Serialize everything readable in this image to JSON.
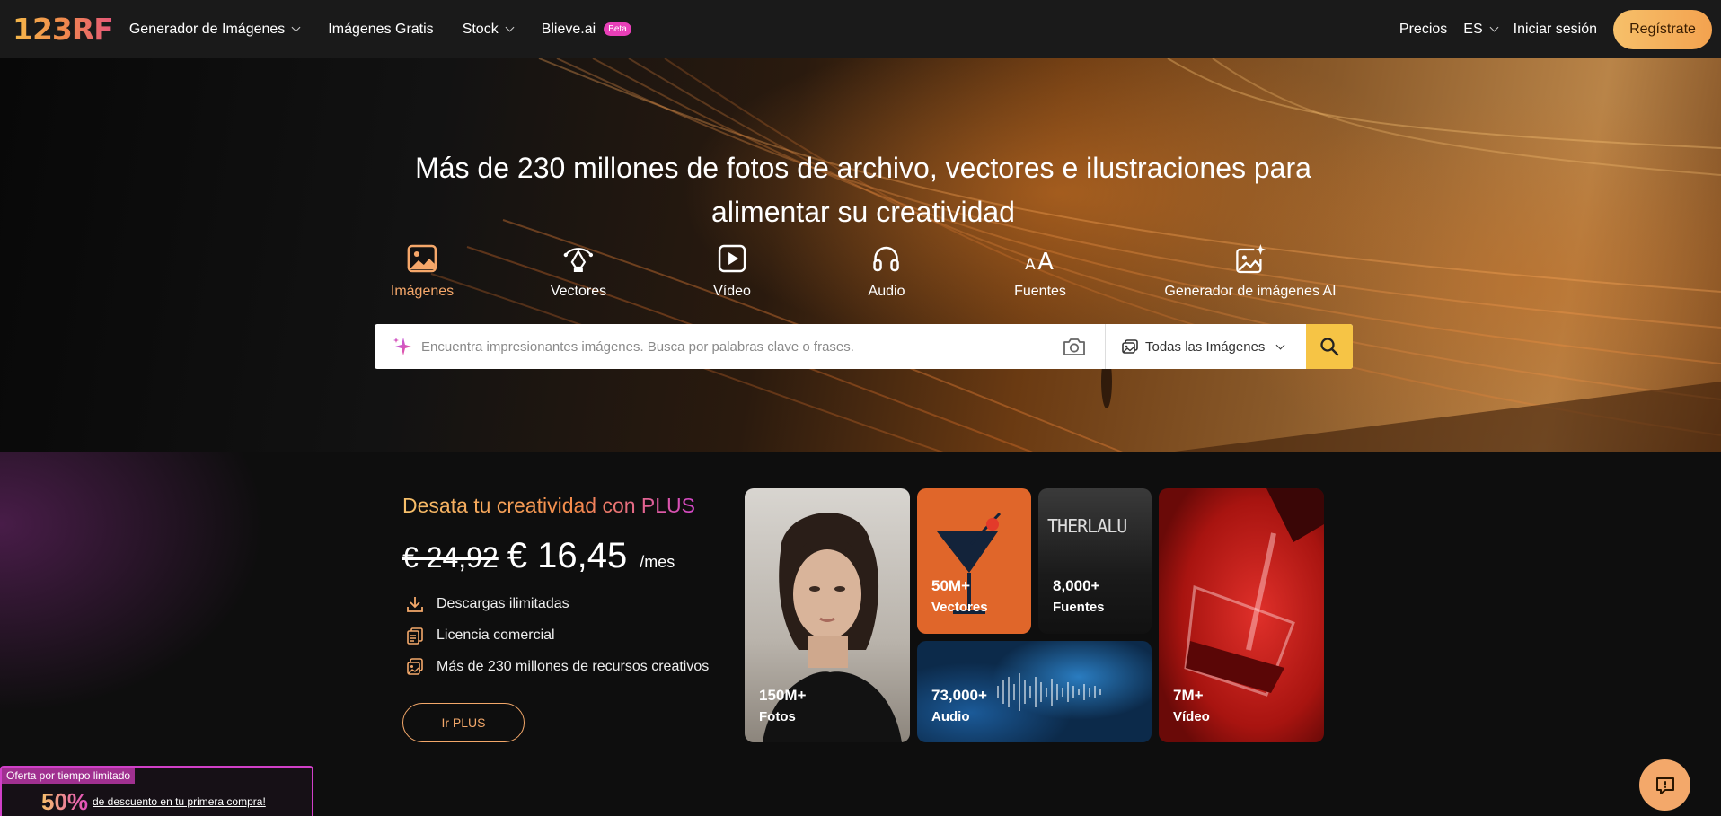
{
  "nav": {
    "logo": "123RF",
    "items": [
      {
        "label": "Generador de Imágenes",
        "dropdown": true
      },
      {
        "label": "Imágenes Gratis"
      },
      {
        "label": "Stock",
        "dropdown": true
      },
      {
        "label": "Blieve.ai",
        "badge": "Beta"
      }
    ],
    "pricing": "Precios",
    "language": "ES",
    "login": "Iniciar sesión",
    "register": "Regístrate"
  },
  "hero": {
    "title_line1": "Más de 230 millones de fotos de archivo, vectores e ilustraciones para",
    "title_line2": "alimentar su creatividad",
    "categories": [
      {
        "label": "Imágenes",
        "icon": "image-icon",
        "active": true
      },
      {
        "label": "Vectores",
        "icon": "vector-pen-icon"
      },
      {
        "label": "Vídeo",
        "icon": "video-play-icon"
      },
      {
        "label": "Audio",
        "icon": "headphones-icon"
      },
      {
        "label": "Fuentes",
        "icon": "font-aa-icon"
      },
      {
        "label": "Generador de imágenes AI",
        "icon": "ai-image-icon"
      }
    ],
    "search": {
      "placeholder": "Encuentra impresionantes imágenes. Busca por palabras clave o frases.",
      "filter": "Todas las Imágenes"
    }
  },
  "promo": {
    "title": "Desata tu creatividad con PLUS",
    "old_price": "€ 24,92",
    "new_price": "€ 16,45",
    "per": "/mes",
    "features": [
      "Descargas ilimitadas",
      "Licencia comercial",
      "Más de 230 millones de recursos creativos"
    ],
    "button": "Ir PLUS",
    "tiles": {
      "photos": {
        "count": "150M+",
        "label": "Fotos"
      },
      "vectors": {
        "count": "50M+",
        "label": "Vectores"
      },
      "fonts": {
        "count": "8,000+",
        "label": "Fuentes",
        "sample": "THERLALU"
      },
      "audio": {
        "count": "73,000+",
        "label": "Audio"
      },
      "video": {
        "count": "7M+",
        "label": "Vídeo"
      }
    }
  },
  "offer": {
    "tag": "Oferta por tiempo limitado",
    "percent": "50%",
    "text": "de descuento en tu primera compra!"
  },
  "colors": {
    "accent": "#f6c445",
    "brand_orange": "#f3a86a",
    "brand_pink": "#e83fb8"
  }
}
